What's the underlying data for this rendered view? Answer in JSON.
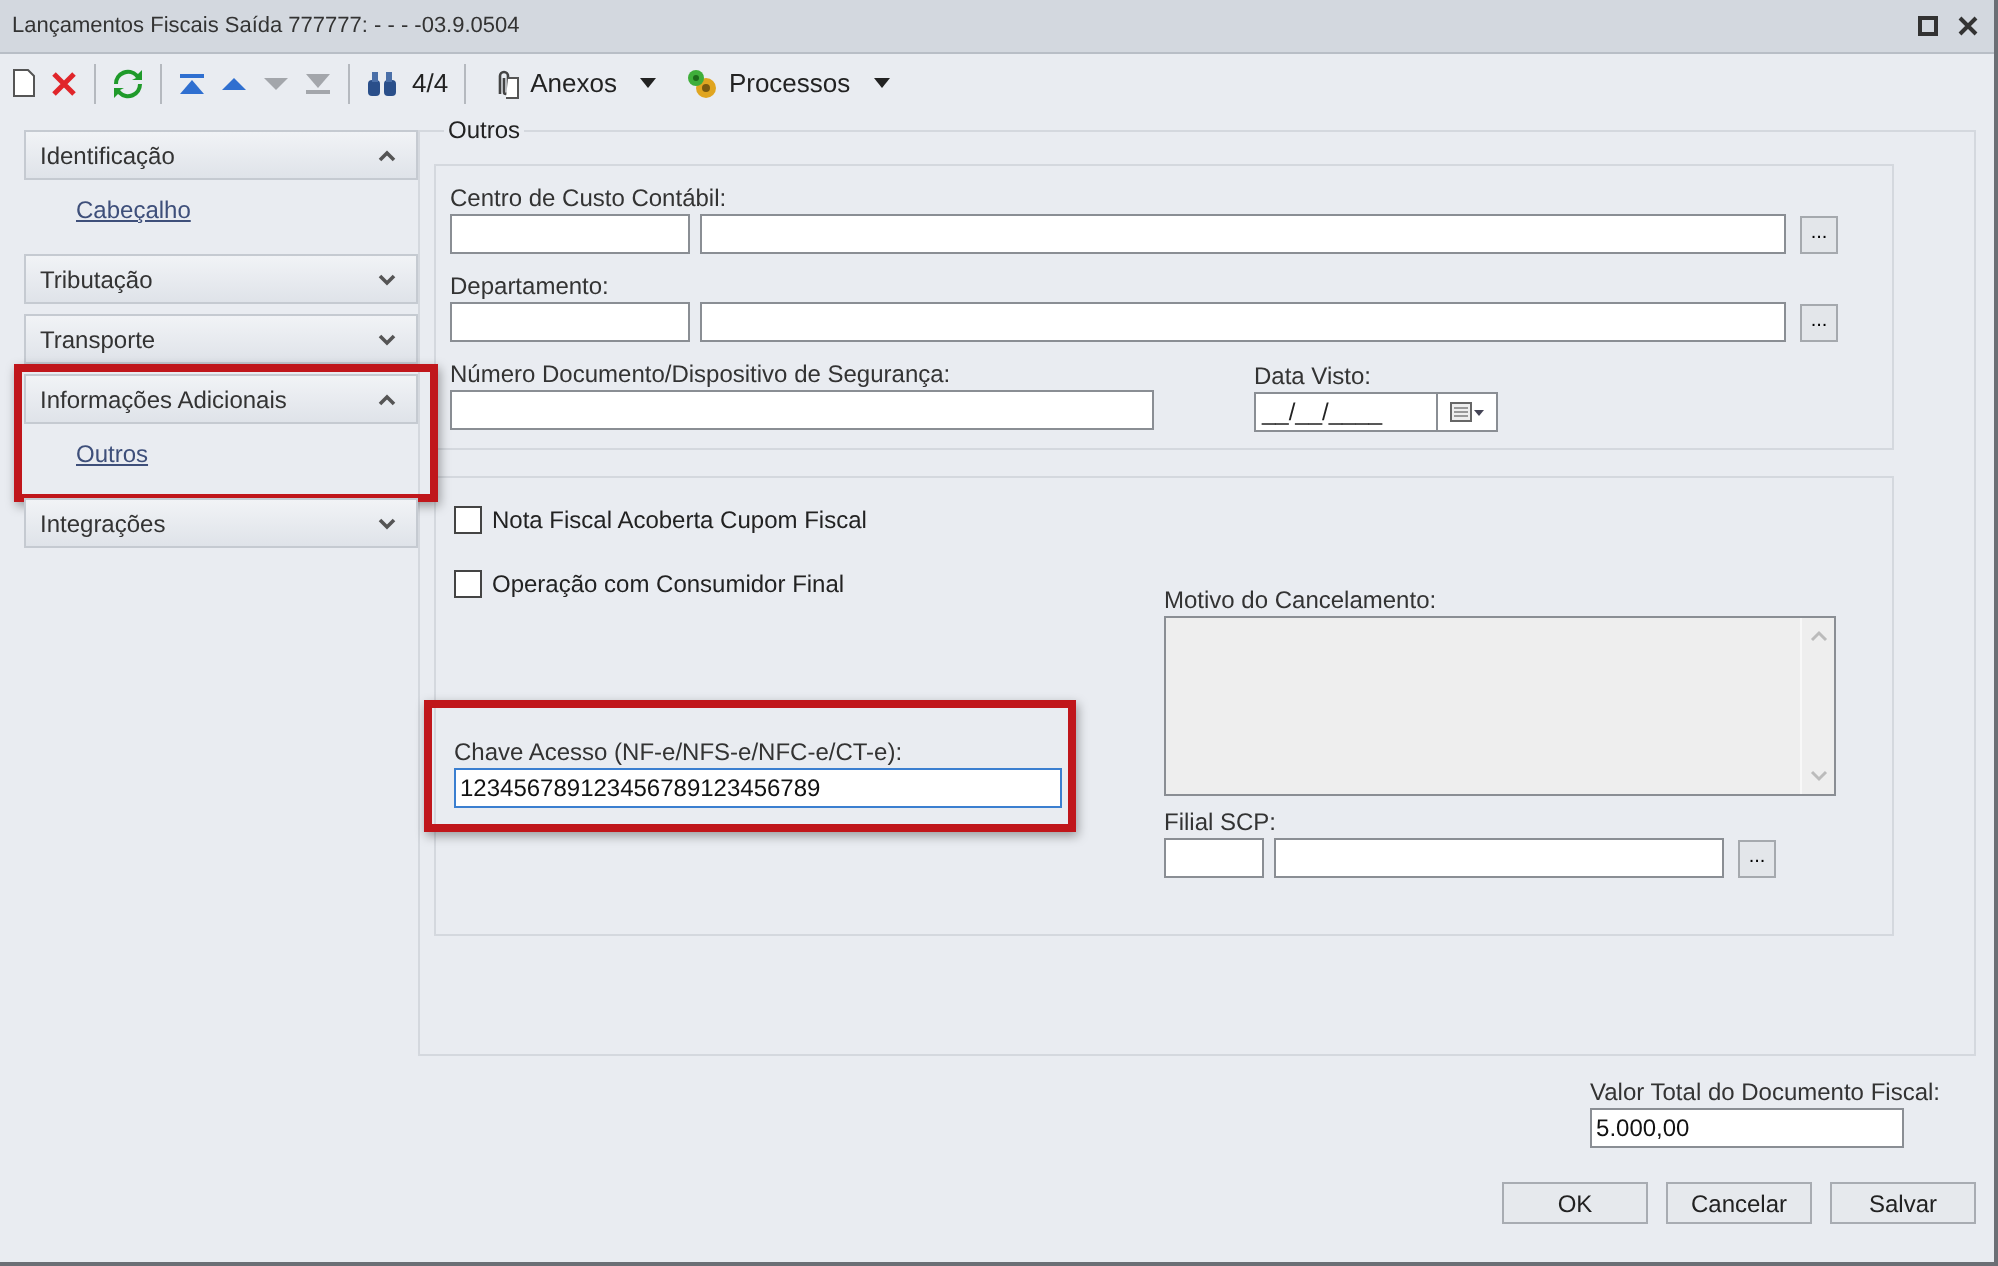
{
  "window": {
    "title": "Lançamentos Fiscais Saída 777777:  - - - -03.9.0504"
  },
  "toolbar": {
    "nav": [
      {
        "kind": "first",
        "disabled": false
      },
      {
        "kind": "prev",
        "disabled": false
      },
      {
        "kind": "next",
        "disabled": true
      },
      {
        "kind": "last",
        "disabled": true
      }
    ],
    "record_counter": "4/4",
    "menus": [
      {
        "kind": "attach",
        "label": "Anexos"
      },
      {
        "kind": "process",
        "label": "Processos"
      }
    ]
  },
  "sidebar": {
    "groups": [
      {
        "label": "Identificação",
        "expanded": true,
        "highlighted": false,
        "items": [
          {
            "label": "Cabeçalho"
          }
        ]
      },
      {
        "label": "Tributação",
        "expanded": false,
        "highlighted": false
      },
      {
        "label": "Transporte",
        "expanded": false,
        "highlighted": false
      },
      {
        "label": "Informações Adicionais",
        "expanded": true,
        "highlighted": true,
        "items": [
          {
            "label": "Outros"
          }
        ]
      },
      {
        "label": "Integrações",
        "expanded": false,
        "highlighted": false
      }
    ]
  },
  "section": {
    "title": "Outros",
    "centro_custo": {
      "label": "Centro de Custo Contábil:",
      "lookup_button": "..."
    },
    "departamento": {
      "label": "Departamento:",
      "lookup_button": "..."
    },
    "numero_documento": {
      "label": "Número Documento/Dispositivo de Segurança:"
    },
    "data_visto": {
      "label": "Data Visto:",
      "value": "__/__/____"
    },
    "checkboxes": [
      {
        "label": "Nota Fiscal  Acoberta Cupom Fiscal",
        "checked": false
      },
      {
        "label": "Operação com Consumidor Final",
        "checked": false
      }
    ],
    "chave_acesso": {
      "label": "Chave Acesso (NF-e/NFS-e/NFC-e/CT-e):",
      "value": "123456789123456789123456789",
      "highlighted": true
    },
    "motivo_cancelamento": {
      "label": "Motivo do Cancelamento:",
      "disabled": true
    },
    "filial_scp": {
      "label": "Filial SCP:",
      "lookup_button": "..."
    }
  },
  "total": {
    "label": "Valor Total do Documento Fiscal:",
    "value": "5.000,00"
  },
  "buttons": [
    "OK",
    "Cancelar",
    "Salvar"
  ]
}
